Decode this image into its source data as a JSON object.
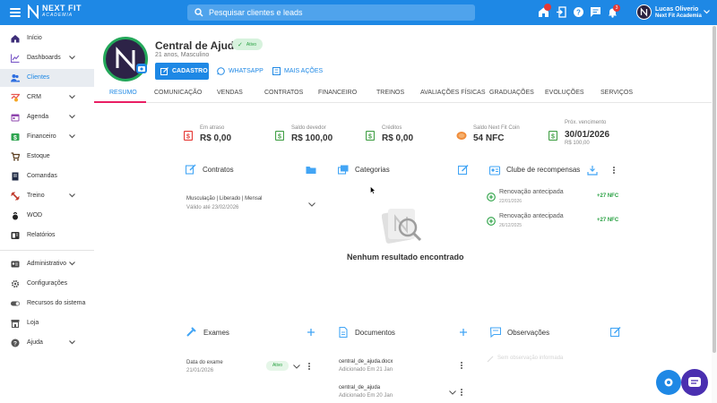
{
  "topbar": {
    "logo_title": "NEXT FIT",
    "logo_sub": "ACADEMIA",
    "search_placeholder": "Pesquisar clientes e leads",
    "notif_count": "3",
    "user_name": "Lucas Oliverio",
    "user_academy": "Next Fit Academia"
  },
  "sidebar": {
    "items": [
      {
        "label": "Início",
        "icon": "home-icon"
      },
      {
        "label": "Dashboards",
        "icon": "chart-line-icon"
      },
      {
        "label": "Clientes",
        "icon": "people-icon"
      },
      {
        "label": "CRM",
        "icon": "crm-icon"
      },
      {
        "label": "Agenda",
        "icon": "calendar-icon"
      },
      {
        "label": "Financeiro",
        "icon": "money-icon"
      },
      {
        "label": "Estoque",
        "icon": "cart-icon"
      },
      {
        "label": "Comandas",
        "icon": "receipt-icon"
      },
      {
        "label": "Treino",
        "icon": "dumbbell-icon"
      },
      {
        "label": "WOD",
        "icon": "kettlebell-icon"
      },
      {
        "label": "Relatórios",
        "icon": "report-icon"
      },
      {
        "label": "Administrativo",
        "icon": "admin-card-icon"
      },
      {
        "label": "Configurações",
        "icon": "gear-icon"
      },
      {
        "label": "Recursos do sistema",
        "icon": "toggle-icon"
      },
      {
        "label": "Loja",
        "icon": "store-icon"
      },
      {
        "label": "Ajuda",
        "icon": "help-icon"
      }
    ]
  },
  "profile": {
    "name": "Central de Ajuda",
    "status": "Ativo",
    "details": "21 anos, Masculino",
    "btn_cadastro": "CADASTRO",
    "btn_whatsapp": "WHATSAPP",
    "btn_mais": "MAIS AÇÕES"
  },
  "tabs": [
    "RESUMO",
    "COMUNICAÇÃO",
    "VENDAS",
    "CONTRATOS",
    "FINANCEIRO",
    "TREINOS",
    "AVALIAÇÕES FÍSICAS",
    "GRADUAÇÕES",
    "EVOLUÇÕES",
    "SERVIÇOS"
  ],
  "stats": [
    {
      "label": "Em atraso",
      "value": "R$ 0,00",
      "color": "#e53935"
    },
    {
      "label": "Saldo devedor",
      "value": "R$ 100,00",
      "color": "#43a047"
    },
    {
      "label": "Créditos",
      "value": "R$ 0,00",
      "color": "#43a047"
    },
    {
      "label": "Saldo Next Fit Coin",
      "value": "54 NFC",
      "color": "#f08c3a"
    },
    {
      "label": "Próx. vencimento",
      "value": "30/01/2026",
      "sub": "R$ 100,00",
      "color": "#43a047"
    }
  ],
  "contracts": {
    "title": "Contratos",
    "item_title": "Musculação | Liberado | Mensal",
    "item_sub": "Válido até 23/02/2026"
  },
  "categories": {
    "title": "Categorias",
    "empty": "Nenhum resultado encontrado"
  },
  "rewards": {
    "title": "Clube de recompensas",
    "items": [
      {
        "name": "Renovação antecipada",
        "date": "22/01/2026",
        "value": "+27 NFC"
      },
      {
        "name": "Renovação antecipada",
        "date": "26/12/2025",
        "value": "+27 NFC"
      }
    ]
  },
  "exams": {
    "title": "Exames",
    "item_title": "Data do exame",
    "item_date": "21/01/2026",
    "item_status": "Ativo"
  },
  "documents": {
    "title": "Documentos",
    "items": [
      {
        "name": "central_de_ajuda.docx",
        "sub": "Adicionado Em 21 Jan"
      },
      {
        "name": "central_de_ajuda",
        "sub": "Adicionado Em 20 Jan"
      }
    ]
  },
  "observations": {
    "title": "Observações",
    "empty": "Sem observação informada"
  },
  "colors": {
    "primary": "#1e88e5",
    "success": "#27a041",
    "tab_indicator": "#e91e63"
  }
}
